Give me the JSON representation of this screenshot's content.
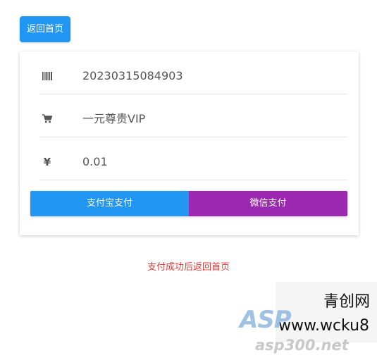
{
  "header": {
    "back_label": "返回首页"
  },
  "order": {
    "order_number": "20230315084903",
    "product_name": "一元尊贵VIP",
    "price": "0.01",
    "price_icon_glyph": "¥",
    "order_icon": "barcode-icon",
    "product_icon": "cart-icon",
    "price_icon": "yen-icon"
  },
  "payment": {
    "alipay_label": "支付宝支付",
    "wechat_label": "微信支付",
    "alipay_color": "#2196f3",
    "wechat_color": "#9c27b0"
  },
  "note": {
    "text": "支付成功后返回首页",
    "color": "#e53935"
  },
  "watermark": {
    "line1": "青创网",
    "line2": "www.wcku8",
    "logo_text": "ASP",
    "site_text": "asp300.net"
  },
  "theme": {
    "primary": "#2196f3",
    "text": "#555555"
  }
}
